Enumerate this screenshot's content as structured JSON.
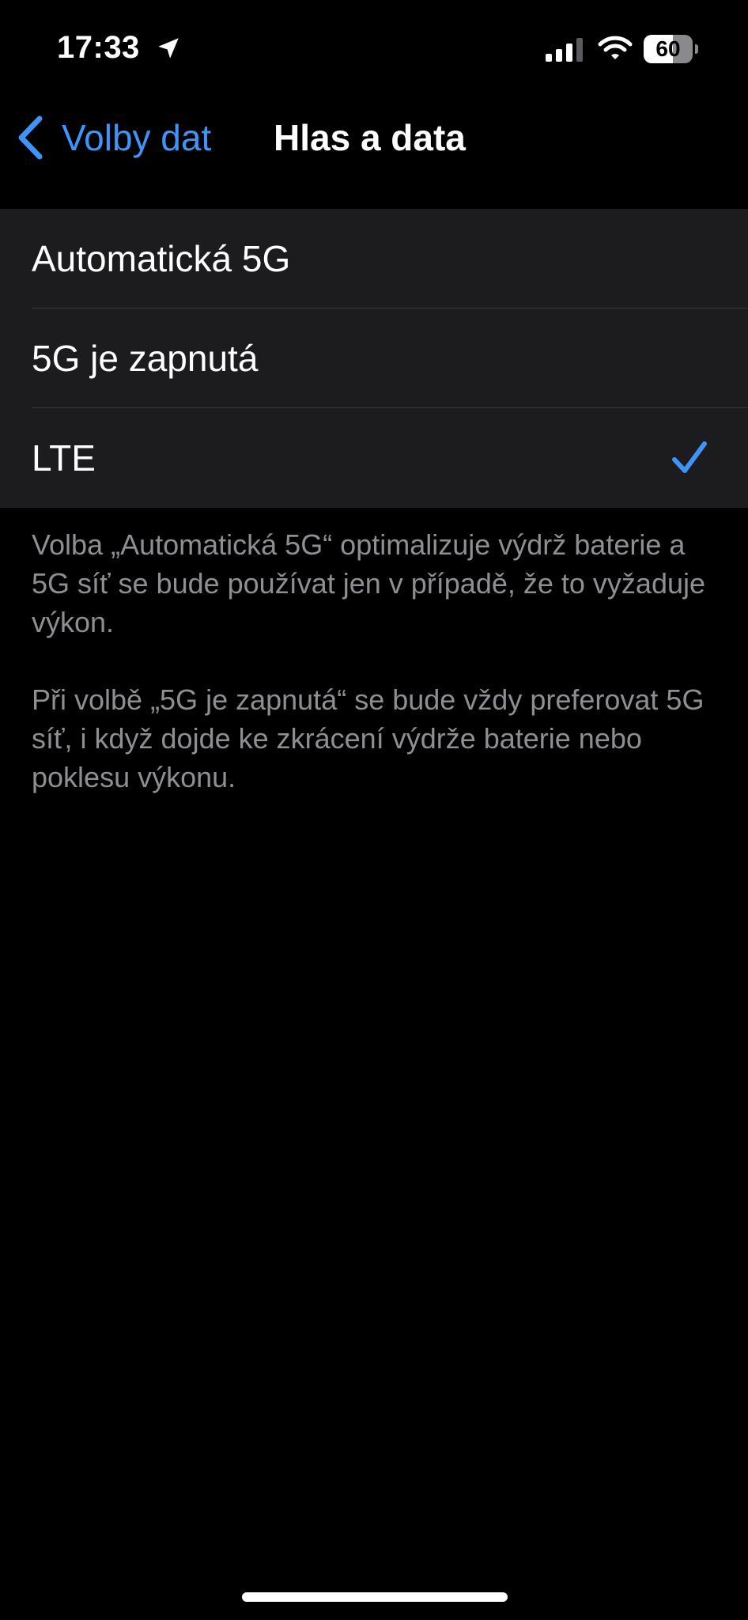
{
  "status_bar": {
    "time": "17:33",
    "battery_level": "60",
    "location_icon": "location-arrow-icon",
    "signal_icon": "cellular-signal-icon",
    "wifi_icon": "wifi-icon"
  },
  "nav": {
    "back_label": "Volby dat",
    "back_icon": "chevron-left-icon",
    "title": "Hlas a data"
  },
  "options": [
    {
      "label": "Automatická 5G",
      "selected": false
    },
    {
      "label": "5G je zapnutá",
      "selected": false
    },
    {
      "label": "LTE",
      "selected": true
    }
  ],
  "footer": {
    "paragraph1": "Volba „Automatická 5G“ optimalizuje výdrž baterie a 5G síť se bude používat jen v případě, že to vyžaduje výkon.",
    "paragraph2": "Při volbě „5G je zapnutá“ se bude vždy preferovat 5G síť, i když dojde ke zkrácení výdrže baterie nebo poklesu výkonu."
  },
  "colors": {
    "background": "#000000",
    "group_background": "#1c1c1e",
    "accent": "#3e94f8",
    "footer_text": "#8e8e93",
    "separator": "#38383a"
  }
}
